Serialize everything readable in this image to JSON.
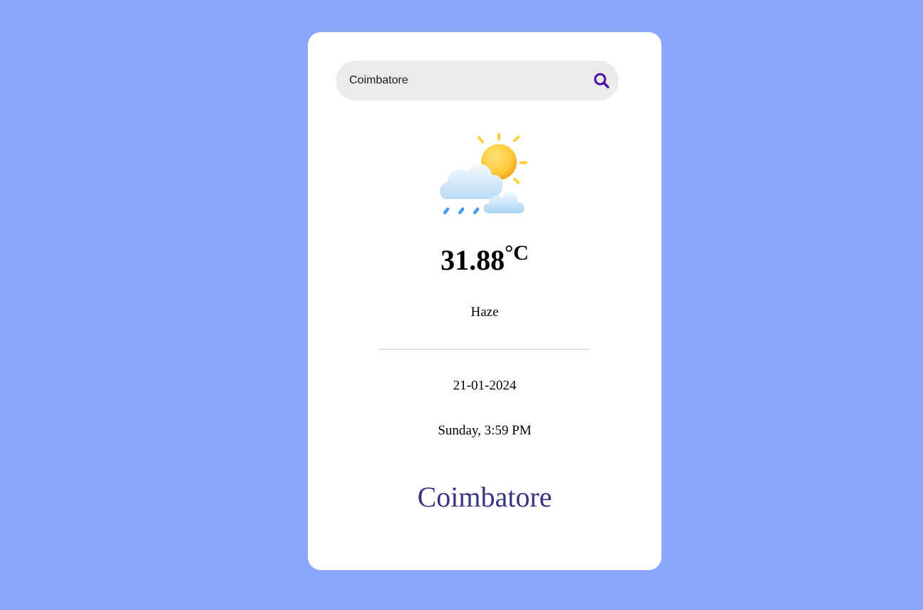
{
  "search": {
    "value": "Coimbatore",
    "icon": "search-icon",
    "icon_color": "#4a0fa8"
  },
  "weather": {
    "icon": "sun-cloud-rain-icon",
    "temperature": "31.88",
    "unit": "°C",
    "condition": "Haze",
    "date": "21-01-2024",
    "day_time": "Sunday, 3:59 PM",
    "city": "Coimbatore"
  },
  "colors": {
    "background": "#89a7fb",
    "card": "#ffffff",
    "search_bg": "#edebe9",
    "city_text": "#3a3583"
  }
}
